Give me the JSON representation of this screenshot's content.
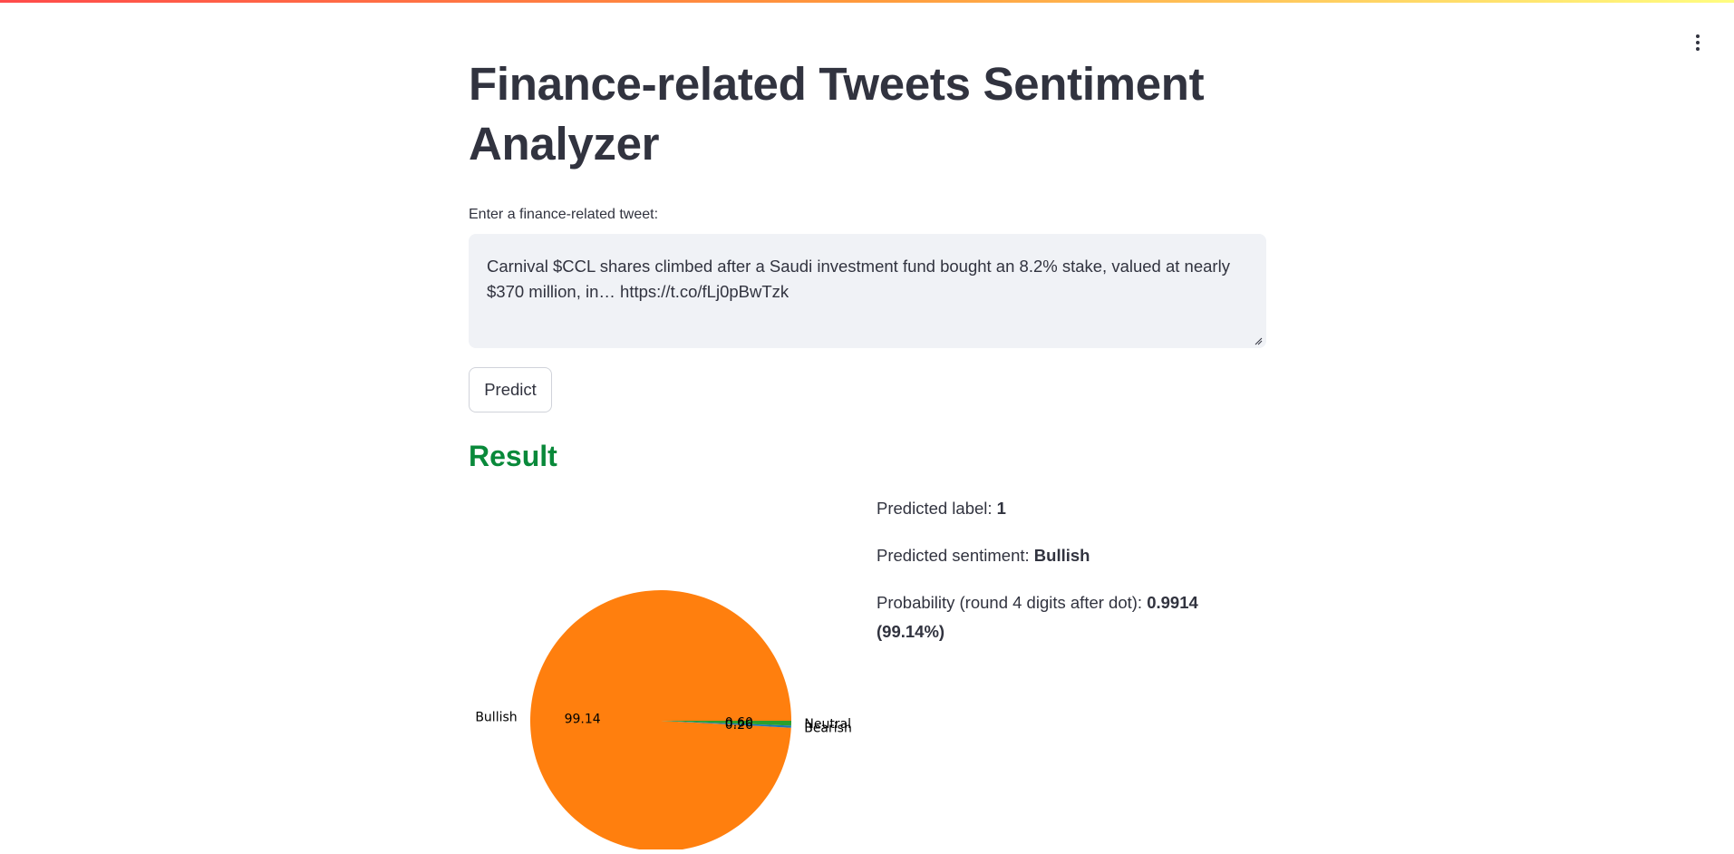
{
  "page": {
    "title": "Finance-related Tweets Sentiment Analyzer"
  },
  "input": {
    "label": "Enter a finance-related tweet:",
    "value": "Carnival $CCL shares climbed after a Saudi investment fund bought an 8.2% stake, valued at nearly $370 million, in… https://t.co/fLj0pBwTzk"
  },
  "actions": {
    "predict_label": "Predict"
  },
  "result": {
    "header": "Result",
    "predicted_label_prefix": "Predicted label: ",
    "predicted_label_value": "1",
    "predicted_sentiment_prefix": "Predicted sentiment: ",
    "predicted_sentiment_value": "Bullish",
    "probability_prefix": "Probability (round 4 digits after dot): ",
    "probability_value": "0.9914",
    "probability_percent": "(99.14%)"
  },
  "chart_data": {
    "type": "pie",
    "categories": [
      "Bullish",
      "Bearish",
      "Neutral"
    ],
    "values": [
      99.14,
      0.26,
      0.6
    ],
    "value_labels": [
      "99.14",
      "0.26",
      "0.60"
    ],
    "colors": [
      "#ff7f0e",
      "#1f77b4",
      "#2ca02c"
    ]
  },
  "colors": {
    "accent_green": "#09893a",
    "text": "#31333f",
    "input_bg": "#f0f2f6"
  },
  "icons": {
    "menu": "vertical-ellipsis-icon",
    "resize": "resize-handle-icon"
  }
}
